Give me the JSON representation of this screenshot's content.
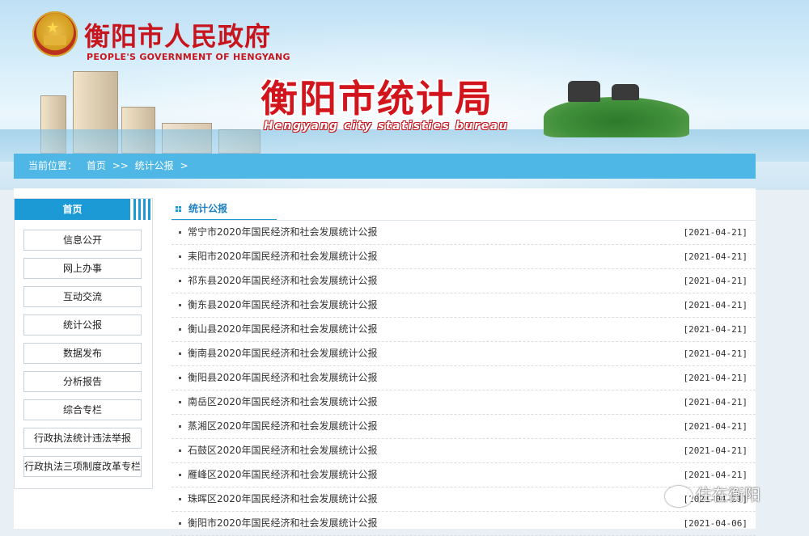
{
  "header": {
    "gov_title": "衡阳市人民政府",
    "gov_subtitle": "PEOPLE'S GOVERNMENT OF HENGYANG",
    "bureau_title": "衡阳市统计局",
    "bureau_subtitle": "Hengyang city statisties bureau"
  },
  "breadcrumb": {
    "prefix": "当前位置：",
    "home": "首页",
    "separator": ">>",
    "current": "统计公报",
    "trail_arrow": ">"
  },
  "sidebar": {
    "head": "首页",
    "items": [
      {
        "label": "信息公开"
      },
      {
        "label": "网上办事"
      },
      {
        "label": "互动交流"
      },
      {
        "label": "统计公报"
      },
      {
        "label": "数据发布"
      },
      {
        "label": "分析报告"
      },
      {
        "label": "综合专栏"
      },
      {
        "label": "行政执法统计违法举报"
      },
      {
        "label": "行政执法三项制度改革专栏"
      }
    ]
  },
  "main": {
    "section_title": "统计公报",
    "rows": [
      {
        "title": "常宁市2020年国民经济和社会发展统计公报",
        "date": "[2021-04-21]"
      },
      {
        "title": "耒阳市2020年国民经济和社会发展统计公报",
        "date": "[2021-04-21]"
      },
      {
        "title": "祁东县2020年国民经济和社会发展统计公报",
        "date": "[2021-04-21]"
      },
      {
        "title": "衡东县2020年国民经济和社会发展统计公报",
        "date": "[2021-04-21]"
      },
      {
        "title": "衡山县2020年国民经济和社会发展统计公报",
        "date": "[2021-04-21]"
      },
      {
        "title": "衡南县2020年国民经济和社会发展统计公报",
        "date": "[2021-04-21]"
      },
      {
        "title": "衡阳县2020年国民经济和社会发展统计公报",
        "date": "[2021-04-21]"
      },
      {
        "title": "南岳区2020年国民经济和社会发展统计公报",
        "date": "[2021-04-21]"
      },
      {
        "title": "蒸湘区2020年国民经济和社会发展统计公报",
        "date": "[2021-04-21]"
      },
      {
        "title": "石鼓区2020年国民经济和社会发展统计公报",
        "date": "[2021-04-21]"
      },
      {
        "title": "雁峰区2020年国民经济和社会发展统计公报",
        "date": "[2021-04-21]"
      },
      {
        "title": "珠晖区2020年国民经济和社会发展统计公报",
        "date": "[2021-04-21]"
      },
      {
        "title": "衡阳市2020年国民经济和社会发展统计公报",
        "date": "[2021-04-06]"
      }
    ]
  },
  "watermark": {
    "text": "住在衡阳"
  },
  "colors": {
    "accent": "#1c9ad6",
    "crumb_bg": "#4fb7e6",
    "brand_red": "#d2141c"
  },
  "icons": [
    "national-emblem-icon",
    "grid-icon",
    "bullet-icon",
    "wechat-icon"
  ]
}
